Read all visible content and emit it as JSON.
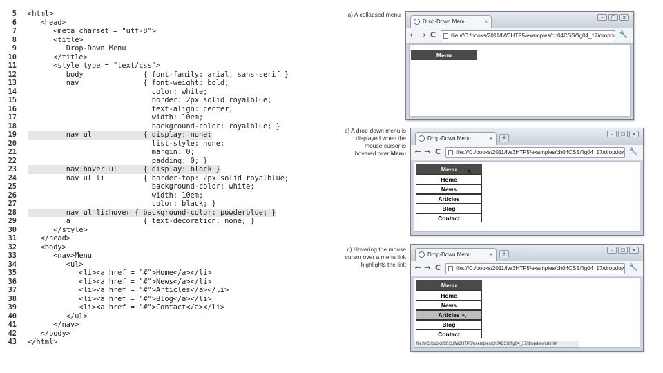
{
  "code": {
    "lines": [
      {
        "n": "5",
        "text": "<html>",
        "hl": false
      },
      {
        "n": "6",
        "text": "   <head>",
        "hl": false
      },
      {
        "n": "7",
        "text": "      <meta charset = \"utf-8\">",
        "hl": false
      },
      {
        "n": "8",
        "text": "      <title>",
        "hl": false
      },
      {
        "n": "9",
        "text": "         Drop-Down Menu",
        "hl": false
      },
      {
        "n": "10",
        "text": "      </title>",
        "hl": false
      },
      {
        "n": "11",
        "text": "      <style type = \"text/css\">",
        "hl": false
      },
      {
        "n": "12",
        "text": "         body              { font-family: arial, sans-serif }",
        "hl": false
      },
      {
        "n": "13",
        "text": "         nav               { font-weight: bold;",
        "hl": false
      },
      {
        "n": "14",
        "text": "                             color: white;",
        "hl": false
      },
      {
        "n": "15",
        "text": "                             border: 2px solid royalblue;",
        "hl": false
      },
      {
        "n": "16",
        "text": "                             text-align: center;",
        "hl": false
      },
      {
        "n": "17",
        "text": "                             width: 10em;",
        "hl": false
      },
      {
        "n": "18",
        "text": "                             background-color: royalblue; }",
        "hl": false
      },
      {
        "n": "19",
        "text": "         nav ul            { display: none;",
        "hl": true
      },
      {
        "n": "20",
        "text": "                             list-style: none;",
        "hl": false
      },
      {
        "n": "21",
        "text": "                             margin: 0;",
        "hl": false
      },
      {
        "n": "22",
        "text": "                             padding: 0; }",
        "hl": false
      },
      {
        "n": "23",
        "text": "         nav:hover ul      { display: block }",
        "hl": true
      },
      {
        "n": "24",
        "text": "         nav ul li         { border-top: 2px solid royalblue;",
        "hl": false
      },
      {
        "n": "25",
        "text": "                             background-color: white;",
        "hl": false
      },
      {
        "n": "26",
        "text": "                             width: 10em;",
        "hl": false
      },
      {
        "n": "27",
        "text": "                             color: black; }",
        "hl": false
      },
      {
        "n": "28",
        "text": "         nav ul li:hover { background-color: powderblue; }",
        "hl": true
      },
      {
        "n": "29",
        "text": "         a                 { text-decoration: none; }",
        "hl": false
      },
      {
        "n": "30",
        "text": "      </style>",
        "hl": false
      },
      {
        "n": "31",
        "text": "   </head>",
        "hl": false
      },
      {
        "n": "32",
        "text": "   <body>",
        "hl": false
      },
      {
        "n": "33",
        "text": "      <nav>Menu",
        "hl": false
      },
      {
        "n": "34",
        "text": "         <ul>",
        "hl": false
      },
      {
        "n": "35",
        "text": "            <li><a href = \"#\">Home</a></li>",
        "hl": false
      },
      {
        "n": "36",
        "text": "            <li><a href = \"#\">News</a></li>",
        "hl": false
      },
      {
        "n": "37",
        "text": "            <li><a href = \"#\">Articles</a></li>",
        "hl": false
      },
      {
        "n": "38",
        "text": "            <li><a href = \"#\">Blog</a></li>",
        "hl": false
      },
      {
        "n": "39",
        "text": "            <li><a href = \"#\">Contact</a></li>",
        "hl": false
      },
      {
        "n": "40",
        "text": "         </ul>",
        "hl": false
      },
      {
        "n": "41",
        "text": "      </nav>",
        "hl": false
      },
      {
        "n": "42",
        "text": "   </body>",
        "hl": false
      },
      {
        "n": "43",
        "text": "</html>",
        "hl": false
      }
    ]
  },
  "captions": {
    "a": "a) A collapsed menu",
    "b_pre": "b) A drop-down menu is displayed when the mouse cursor is hovered over",
    "b_bold": "Menu",
    "c": "c) Hovering the mouse cursor over a menu link highlights the link"
  },
  "browser": {
    "tab_title": "Drop-Down Menu",
    "tab_close": "×",
    "new_tab": "+",
    "url": "file:///C:/books/2011/IW3HTP5/examples/ch04CSS/fig04_17/dropdown.html",
    "win_min": "–",
    "win_max": "□",
    "win_close": "x",
    "back": "←",
    "forward": "→",
    "reload": "C",
    "star": "☆",
    "wrench": "🔧",
    "status_url": "file:///C:/books/2011/IW3HTP5/examples/ch04CSS/fig04_17/dropdown.html#"
  },
  "menu": {
    "title": "Menu",
    "items": [
      "Home",
      "News",
      "Articles",
      "Blog",
      "Contact"
    ],
    "hover_index_c": 2
  },
  "cursor_glyph": "↖"
}
